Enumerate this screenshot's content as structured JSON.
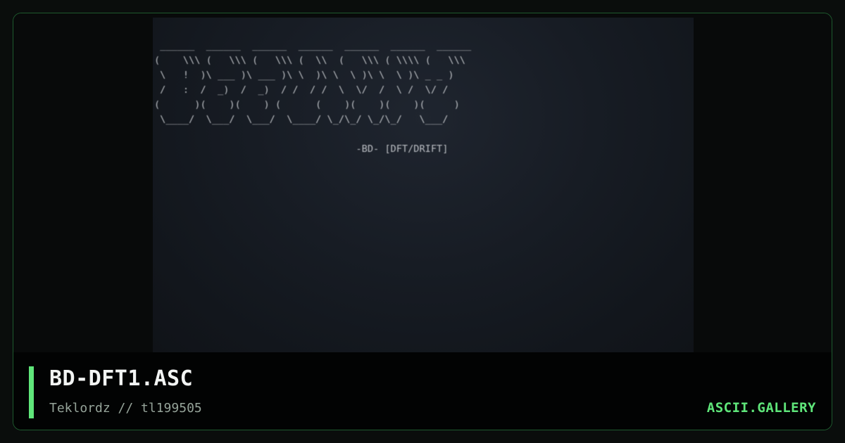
{
  "artwork": {
    "ascii_lines": [
      " ______  ______  ______  ______  ______  ______  ______",
      "(    \\\\\\ (   \\\\\\ (   \\\\\\ (  \\\\  (   \\\\\\ ( \\\\\\\\ (   \\\\\\",
      " \\   !  )\\ ___ )\\ ___ )\\ \\  )\\ \\  \\ )\\ \\  \\ )\\ _ _ )",
      " /   :  /  _)  /  _)  / /  / /  \\  \\/  /  \\ /  \\/ /",
      "(      )(    )(    ) (      (    )(    )(    )(     )",
      " \\____/  \\___/  \\___/  \\____/ \\_/\\_/ \\_/\\_/   \\___/",
      "",
      "                                   -BD- [DFT/DRIFT]"
    ]
  },
  "caption": {
    "title": "BD-DFT1.ASC",
    "meta": "Teklordz // tl199505",
    "brand": "ASCII.GALLERY"
  },
  "colors": {
    "accent": "#5fe67a",
    "frame_border": "#1e5a2e",
    "title_text": "#f2f4f3",
    "meta_text": "#96a49a"
  }
}
